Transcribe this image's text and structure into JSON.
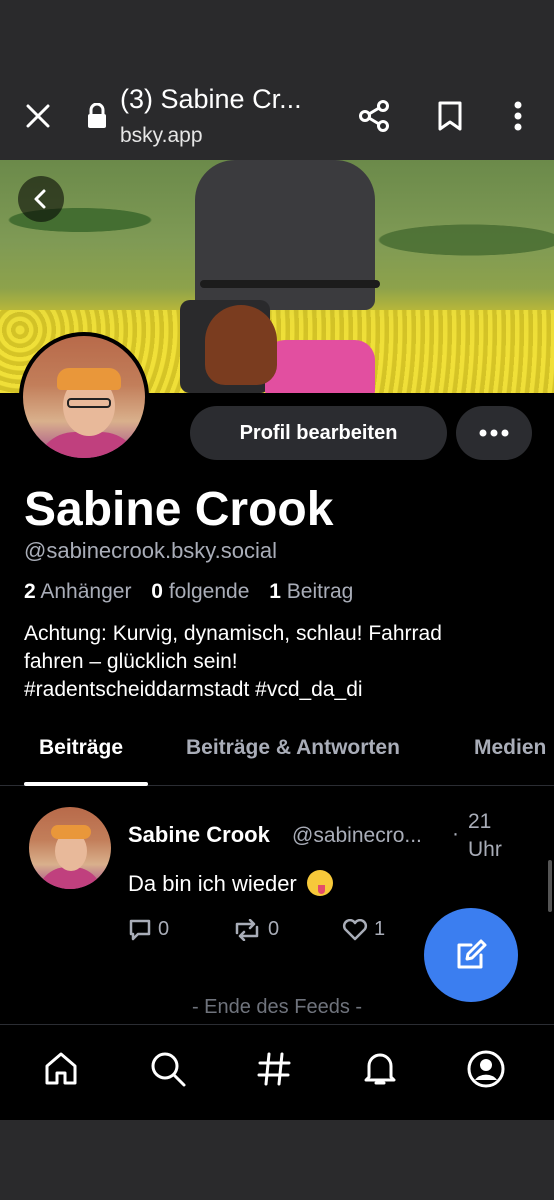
{
  "browser": {
    "title": "(3) Sabine Cr...",
    "url": "bsky.app"
  },
  "profile": {
    "edit_button": "Profil bearbeiten",
    "name": "Sabine Crook",
    "handle": "@sabinecrook.bsky.social",
    "stats": [
      {
        "count": "2",
        "label": "Anhänger"
      },
      {
        "count": "0",
        "label": "folgende"
      },
      {
        "count": "1",
        "label": "Beitrag"
      }
    ],
    "bio_line1": "Achtung: Kurvig, dynamisch, schlau! Fahrrad",
    "bio_line2": "fahren – glücklich sein!",
    "bio_line3": "#radentscheiddarmstadt  #vcd_da_di"
  },
  "tabs": [
    {
      "label": "Beiträge",
      "active": true
    },
    {
      "label": "Beiträge & Antworten",
      "active": false
    },
    {
      "label": "Medien",
      "active": false
    }
  ],
  "post": {
    "author": "Sabine Crook",
    "handle": "@sabinecro...",
    "dot": "·",
    "time": "21 Uhr",
    "text": "Da bin ich wieder",
    "replies": "0",
    "reposts": "0",
    "likes": "1"
  },
  "feed_end": "- Ende des Feeds -",
  "colors": {
    "accent": "#3b7ef0",
    "background": "#000000",
    "muted": "#a9adb8",
    "button_bg": "#2b2c30"
  }
}
